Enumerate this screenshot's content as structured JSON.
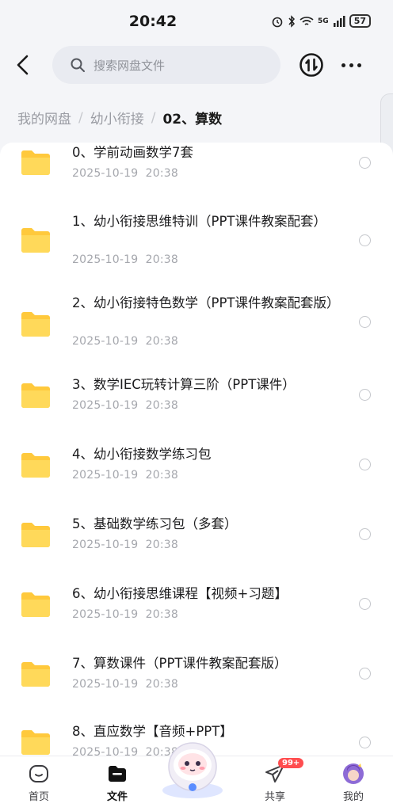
{
  "status_bar": {
    "time": "20:42",
    "network": "5G",
    "battery": "57"
  },
  "header": {
    "search_placeholder": "搜索网盘文件"
  },
  "breadcrumb": {
    "items": [
      "我的网盘",
      "幼小衔接"
    ],
    "current": "02、算数"
  },
  "files": [
    {
      "name": "0、学前动画数学7套",
      "date": "2025-10-19  20:38"
    },
    {
      "name": "1、幼小衔接思维特训（PPT课件教案配套）",
      "date": "2025-10-19  20:38"
    },
    {
      "name": "2、幼小衔接特色数学（PPT课件教案配套版）",
      "date": "2025-10-19  20:38"
    },
    {
      "name": "3、数学IEC玩转计算三阶（PPT课件）",
      "date": "2025-10-19  20:38"
    },
    {
      "name": "4、幼小衔接数学练习包",
      "date": "2025-10-19  20:38"
    },
    {
      "name": "5、基础数学练习包（多套）",
      "date": "2025-10-19  20:38"
    },
    {
      "name": "6、幼小衔接思维课程【视频+习题】",
      "date": "2025-10-19  20:38"
    },
    {
      "name": "7、算数课件（PPT课件教案配套版）",
      "date": "2025-10-19  20:38"
    },
    {
      "name": "8、直应数学【音频+PPT】",
      "date": "2025-10-19  20:38"
    }
  ],
  "nav": {
    "home": "首页",
    "files": "文件",
    "share": "共享",
    "share_badge": "99+",
    "me": "我的"
  },
  "colors": {
    "folder": "#ffc93c",
    "accent": "#1a1a1a",
    "badge": "#ff4d4f"
  }
}
